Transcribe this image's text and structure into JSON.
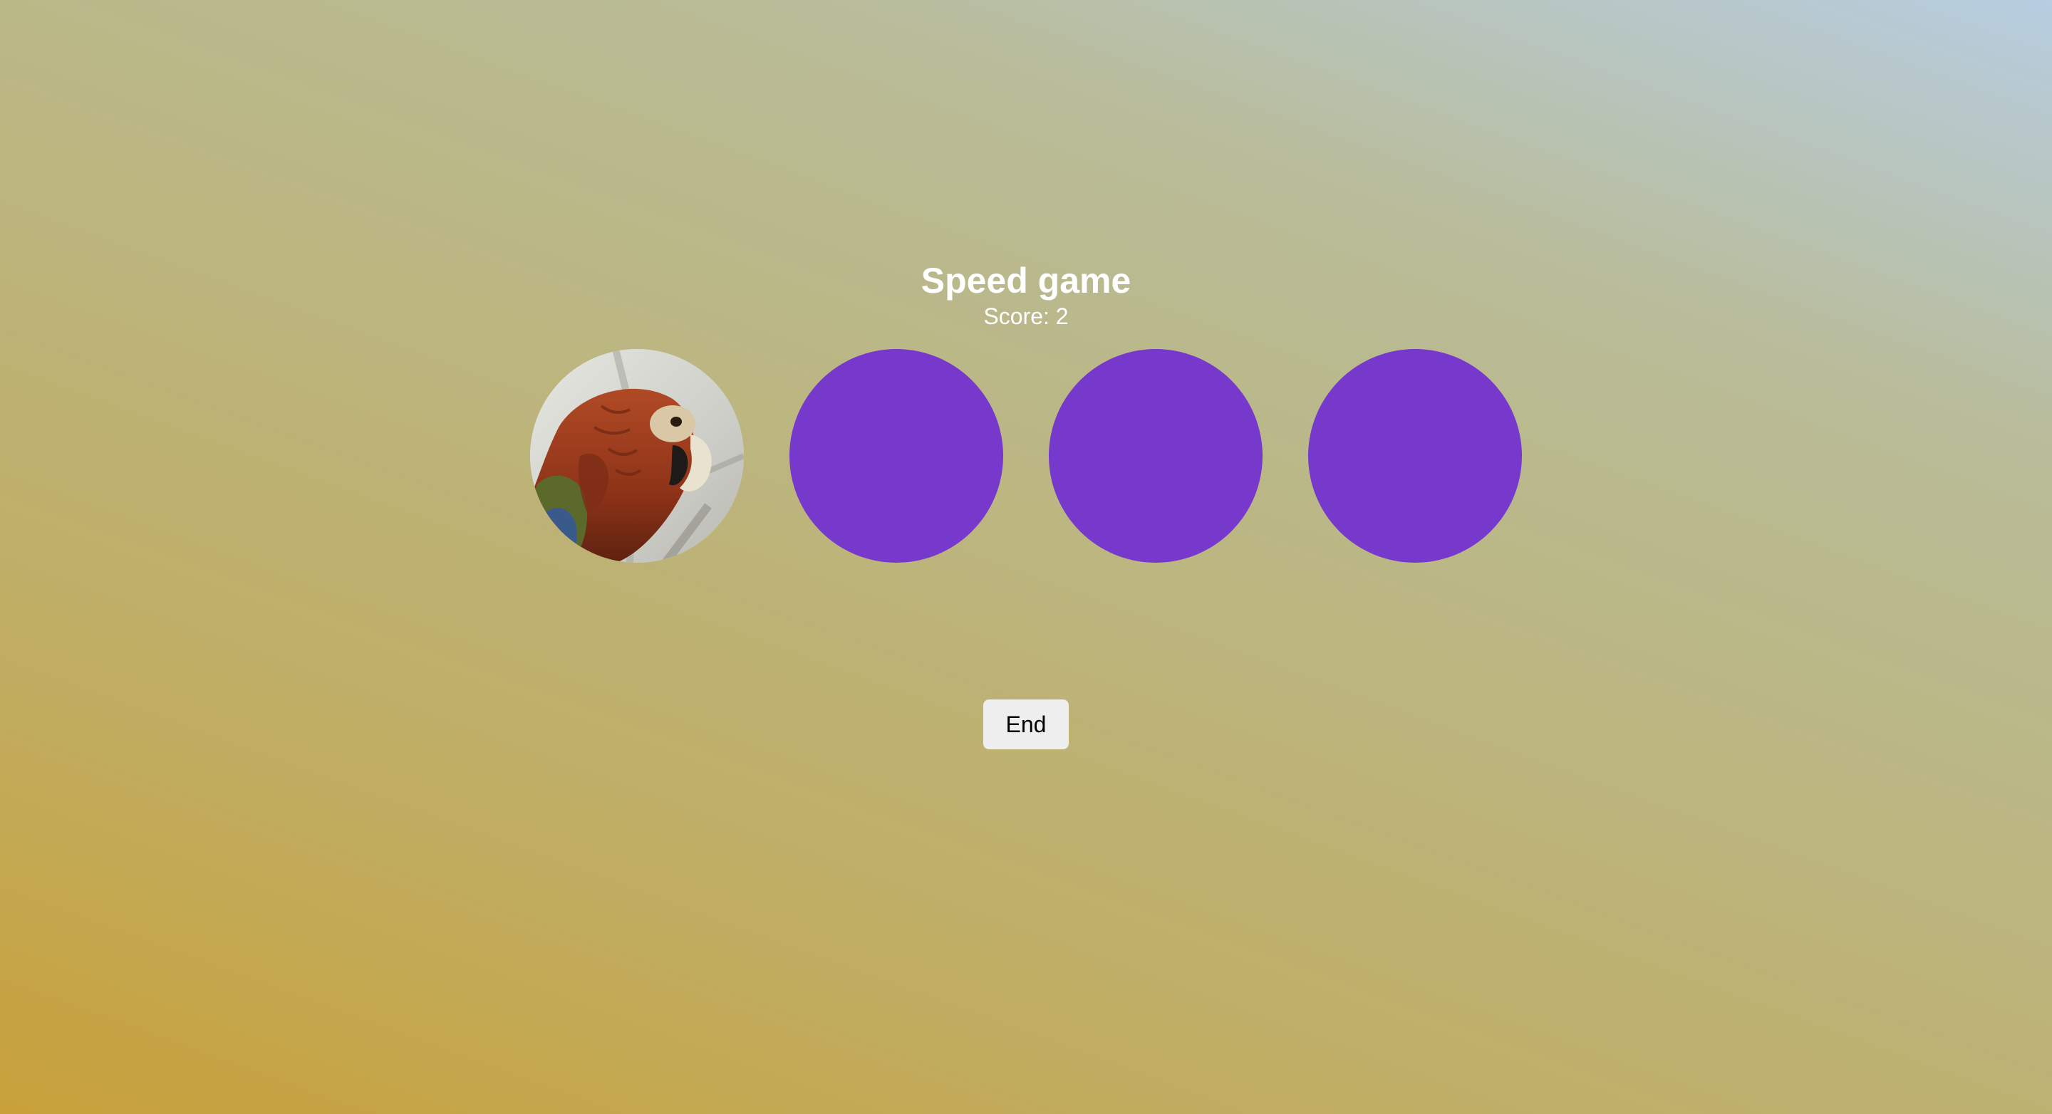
{
  "game": {
    "title": "Speed game",
    "score_text": "Score: 2"
  },
  "circles": [
    {
      "state": "active",
      "content": "parrot-image"
    },
    {
      "state": "idle",
      "color": "#7639cc"
    },
    {
      "state": "idle",
      "color": "#7639cc"
    },
    {
      "state": "idle",
      "color": "#7639cc"
    }
  ],
  "controls": {
    "end_label": "End"
  },
  "colors": {
    "circle": "#7639cc",
    "text": "#ffffff",
    "button_bg": "#eeeeee"
  }
}
